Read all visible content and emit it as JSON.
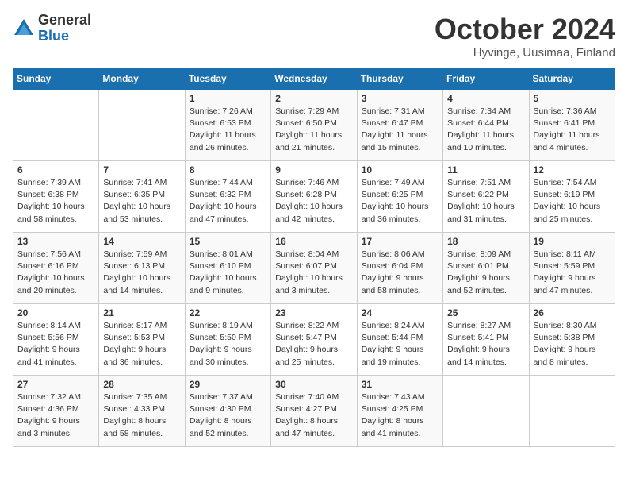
{
  "logo": {
    "general": "General",
    "blue": "Blue"
  },
  "title": "October 2024",
  "subtitle": "Hyvinge, Uusimaa, Finland",
  "days_of_week": [
    "Sunday",
    "Monday",
    "Tuesday",
    "Wednesday",
    "Thursday",
    "Friday",
    "Saturday"
  ],
  "weeks": [
    [
      {
        "day": "",
        "details": ""
      },
      {
        "day": "",
        "details": ""
      },
      {
        "day": "1",
        "details": "Sunrise: 7:26 AM\nSunset: 6:53 PM\nDaylight: 11 hours\nand 26 minutes."
      },
      {
        "day": "2",
        "details": "Sunrise: 7:29 AM\nSunset: 6:50 PM\nDaylight: 11 hours\nand 21 minutes."
      },
      {
        "day": "3",
        "details": "Sunrise: 7:31 AM\nSunset: 6:47 PM\nDaylight: 11 hours\nand 15 minutes."
      },
      {
        "day": "4",
        "details": "Sunrise: 7:34 AM\nSunset: 6:44 PM\nDaylight: 11 hours\nand 10 minutes."
      },
      {
        "day": "5",
        "details": "Sunrise: 7:36 AM\nSunset: 6:41 PM\nDaylight: 11 hours\nand 4 minutes."
      }
    ],
    [
      {
        "day": "6",
        "details": "Sunrise: 7:39 AM\nSunset: 6:38 PM\nDaylight: 10 hours\nand 58 minutes."
      },
      {
        "day": "7",
        "details": "Sunrise: 7:41 AM\nSunset: 6:35 PM\nDaylight: 10 hours\nand 53 minutes."
      },
      {
        "day": "8",
        "details": "Sunrise: 7:44 AM\nSunset: 6:32 PM\nDaylight: 10 hours\nand 47 minutes."
      },
      {
        "day": "9",
        "details": "Sunrise: 7:46 AM\nSunset: 6:28 PM\nDaylight: 10 hours\nand 42 minutes."
      },
      {
        "day": "10",
        "details": "Sunrise: 7:49 AM\nSunset: 6:25 PM\nDaylight: 10 hours\nand 36 minutes."
      },
      {
        "day": "11",
        "details": "Sunrise: 7:51 AM\nSunset: 6:22 PM\nDaylight: 10 hours\nand 31 minutes."
      },
      {
        "day": "12",
        "details": "Sunrise: 7:54 AM\nSunset: 6:19 PM\nDaylight: 10 hours\nand 25 minutes."
      }
    ],
    [
      {
        "day": "13",
        "details": "Sunrise: 7:56 AM\nSunset: 6:16 PM\nDaylight: 10 hours\nand 20 minutes."
      },
      {
        "day": "14",
        "details": "Sunrise: 7:59 AM\nSunset: 6:13 PM\nDaylight: 10 hours\nand 14 minutes."
      },
      {
        "day": "15",
        "details": "Sunrise: 8:01 AM\nSunset: 6:10 PM\nDaylight: 10 hours\nand 9 minutes."
      },
      {
        "day": "16",
        "details": "Sunrise: 8:04 AM\nSunset: 6:07 PM\nDaylight: 10 hours\nand 3 minutes."
      },
      {
        "day": "17",
        "details": "Sunrise: 8:06 AM\nSunset: 6:04 PM\nDaylight: 9 hours\nand 58 minutes."
      },
      {
        "day": "18",
        "details": "Sunrise: 8:09 AM\nSunset: 6:01 PM\nDaylight: 9 hours\nand 52 minutes."
      },
      {
        "day": "19",
        "details": "Sunrise: 8:11 AM\nSunset: 5:59 PM\nDaylight: 9 hours\nand 47 minutes."
      }
    ],
    [
      {
        "day": "20",
        "details": "Sunrise: 8:14 AM\nSunset: 5:56 PM\nDaylight: 9 hours\nand 41 minutes."
      },
      {
        "day": "21",
        "details": "Sunrise: 8:17 AM\nSunset: 5:53 PM\nDaylight: 9 hours\nand 36 minutes."
      },
      {
        "day": "22",
        "details": "Sunrise: 8:19 AM\nSunset: 5:50 PM\nDaylight: 9 hours\nand 30 minutes."
      },
      {
        "day": "23",
        "details": "Sunrise: 8:22 AM\nSunset: 5:47 PM\nDaylight: 9 hours\nand 25 minutes."
      },
      {
        "day": "24",
        "details": "Sunrise: 8:24 AM\nSunset: 5:44 PM\nDaylight: 9 hours\nand 19 minutes."
      },
      {
        "day": "25",
        "details": "Sunrise: 8:27 AM\nSunset: 5:41 PM\nDaylight: 9 hours\nand 14 minutes."
      },
      {
        "day": "26",
        "details": "Sunrise: 8:30 AM\nSunset: 5:38 PM\nDaylight: 9 hours\nand 8 minutes."
      }
    ],
    [
      {
        "day": "27",
        "details": "Sunrise: 7:32 AM\nSunset: 4:36 PM\nDaylight: 9 hours\nand 3 minutes."
      },
      {
        "day": "28",
        "details": "Sunrise: 7:35 AM\nSunset: 4:33 PM\nDaylight: 8 hours\nand 58 minutes."
      },
      {
        "day": "29",
        "details": "Sunrise: 7:37 AM\nSunset: 4:30 PM\nDaylight: 8 hours\nand 52 minutes."
      },
      {
        "day": "30",
        "details": "Sunrise: 7:40 AM\nSunset: 4:27 PM\nDaylight: 8 hours\nand 47 minutes."
      },
      {
        "day": "31",
        "details": "Sunrise: 7:43 AM\nSunset: 4:25 PM\nDaylight: 8 hours\nand 41 minutes."
      },
      {
        "day": "",
        "details": ""
      },
      {
        "day": "",
        "details": ""
      }
    ]
  ]
}
